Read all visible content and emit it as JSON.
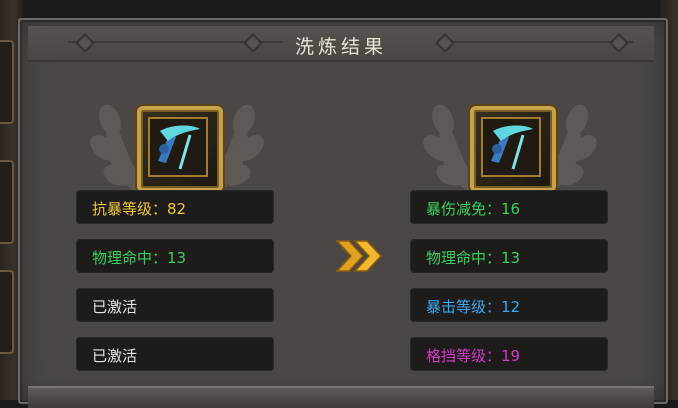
{
  "window": {
    "title": "洗炼结果"
  },
  "before": {
    "stats": [
      {
        "text": "抗暴等级：82",
        "color": "#f0c63a"
      },
      {
        "text": "物理命中：13",
        "color": "#3ad15a"
      },
      {
        "text": "已激活",
        "color": "#e8e4dc"
      },
      {
        "text": "已激活",
        "color": "#e8e4dc"
      }
    ]
  },
  "after": {
    "stats": [
      {
        "text": "暴伤减免：16",
        "color": "#3ad15a"
      },
      {
        "text": "物理命中：13",
        "color": "#3ad15a"
      },
      {
        "text": "暴击等级：12",
        "color": "#3aa8f0"
      },
      {
        "text": "格挡等级：19",
        "color": "#d338c8"
      }
    ]
  },
  "icons": {
    "item": "weapon-scythe-icon",
    "arrow": "double-chevron-right-icon",
    "laurel": "laurel-wreath-icon"
  }
}
